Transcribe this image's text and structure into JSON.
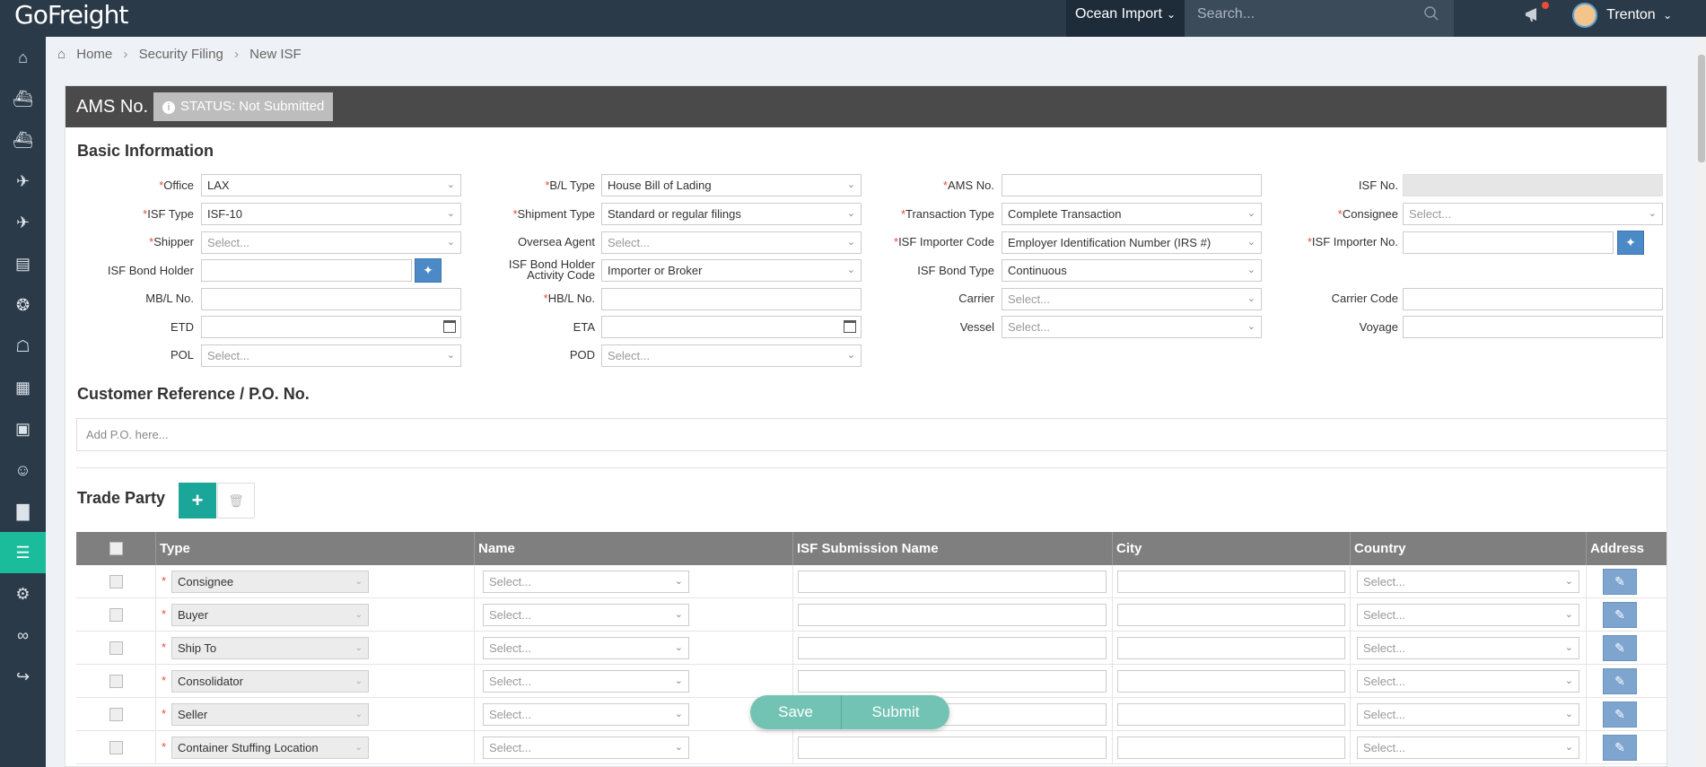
{
  "app": {
    "logo": "GoFreight"
  },
  "topbar": {
    "mode": "Ocean Import",
    "search_placeholder": "Search...",
    "user_name": "Trenton"
  },
  "sidebar": {
    "items": [
      "home-icon",
      "ship-icon",
      "vessel-icon",
      "air-import-icon",
      "air-export-icon",
      "truck-icon",
      "warehouse-icon",
      "building-icon",
      "calculator-icon",
      "briefcase-icon",
      "contact-search-icon",
      "bar-chart-icon",
      "document-icon",
      "gear-icon",
      "link-icon",
      "export-icon"
    ],
    "active_index": 12
  },
  "breadcrumb": {
    "home": "Home",
    "level1": "Security Filing",
    "level2": "New ISF"
  },
  "header": {
    "title": "AMS No.",
    "status": "STATUS: Not Submitted"
  },
  "basic": {
    "title": "Basic Information",
    "office": {
      "label": "Office",
      "value": "LAX"
    },
    "isf_type": {
      "label": "ISF Type",
      "value": "ISF-10"
    },
    "shipper": {
      "label": "Shipper",
      "value": "Select..."
    },
    "isf_bond_holder": {
      "label": "ISF Bond Holder",
      "value": ""
    },
    "mbl_no": {
      "label": "MB/L No.",
      "value": ""
    },
    "etd": {
      "label": "ETD",
      "value": ""
    },
    "pol": {
      "label": "POL",
      "value": "Select..."
    },
    "bl_type": {
      "label": "B/L Type",
      "value": "House Bill of Lading"
    },
    "shipment_type": {
      "label": "Shipment Type",
      "value": "Standard or regular filings"
    },
    "oversea_agent": {
      "label": "Oversea Agent",
      "value": "Select..."
    },
    "bond_activity": {
      "label_1": "ISF Bond Holder",
      "label_2": "Activity Code",
      "value": "Importer or Broker"
    },
    "hbl_no": {
      "label": "HB/L No.",
      "value": ""
    },
    "eta": {
      "label": "ETA",
      "value": ""
    },
    "pod": {
      "label": "POD",
      "value": "Select..."
    },
    "ams_no": {
      "label": "AMS No.",
      "value": ""
    },
    "transaction_type": {
      "label": "Transaction Type",
      "value": "Complete Transaction"
    },
    "importer_code": {
      "label": "ISF Importer Code",
      "value": "Employer Identification Number (IRS #)"
    },
    "bond_type": {
      "label": "ISF Bond Type",
      "value": "Continuous"
    },
    "carrier": {
      "label": "Carrier",
      "value": "Select..."
    },
    "vessel": {
      "label": "Vessel",
      "value": "Select..."
    },
    "isf_no": {
      "label": "ISF No.",
      "value": ""
    },
    "consignee": {
      "label": "Consignee",
      "value": "Select..."
    },
    "importer_no": {
      "label": "ISF Importer No.",
      "value": ""
    },
    "carrier_code": {
      "label": "Carrier Code",
      "value": ""
    },
    "voyage": {
      "label": "Voyage",
      "value": ""
    }
  },
  "po": {
    "title": "Customer Reference / P.O. No.",
    "placeholder": "Add P.O. here..."
  },
  "trade": {
    "title": "Trade Party",
    "columns": [
      "Type",
      "Name",
      "ISF Submission Name",
      "City",
      "Country",
      "Address"
    ],
    "select_placeholder": "Select...",
    "rows": [
      "Consignee",
      "Buyer",
      "Ship To",
      "Consolidator",
      "Seller",
      "Container Stuffing Location"
    ]
  },
  "actions": {
    "save": "Save",
    "submit": "Submit"
  }
}
